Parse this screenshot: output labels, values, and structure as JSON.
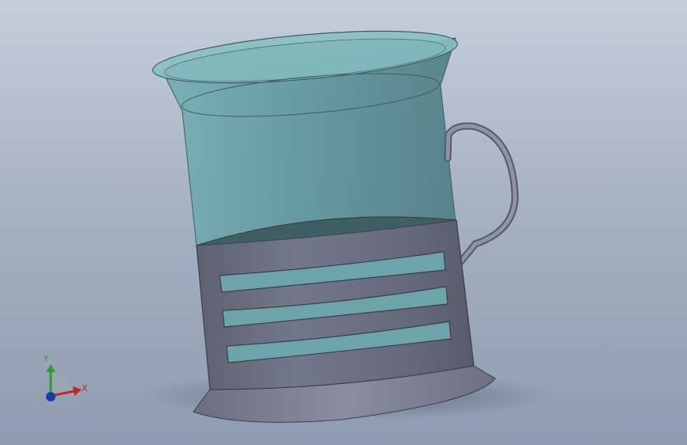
{
  "viewport": {
    "background_top": "#c6cedb",
    "background_bottom": "#8f9bb0"
  },
  "model": {
    "description_icon": "glass-tea-holder-model",
    "glass_color": "#5f9aa0",
    "holder_color": "#6b6f80",
    "handle_color": "#7a7e8e"
  },
  "triad": {
    "x_label": "X",
    "y_label": "Y",
    "x_color": "#c0282a",
    "y_color": "#2f9a2f",
    "z_color": "#1f3aa8"
  }
}
